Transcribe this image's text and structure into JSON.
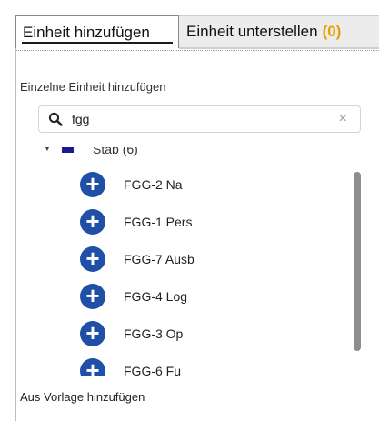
{
  "tabs": {
    "add_label": "Einheit hinzufügen",
    "subordinate_label": "Einheit unterstellen",
    "subordinate_count": "(0)"
  },
  "section": {
    "title": "Einzelne Einheit hinzufügen"
  },
  "search": {
    "value": "fgg",
    "placeholder": "",
    "clear_symbol": "×"
  },
  "group": {
    "label": "Stab (6)"
  },
  "items": [
    {
      "label": "FGG-2 Na"
    },
    {
      "label": "FGG-1 Pers"
    },
    {
      "label": "FGG-7 Ausb"
    },
    {
      "label": "FGG-4 Log"
    },
    {
      "label": "FGG-3 Op"
    },
    {
      "label": "FGG-6 Fu"
    }
  ],
  "footer": {
    "label": "Aus Vorlage hinzufügen"
  },
  "colors": {
    "accent": "#1f4fa6",
    "count": "#e8a000",
    "flag": "#1d1a8c"
  }
}
